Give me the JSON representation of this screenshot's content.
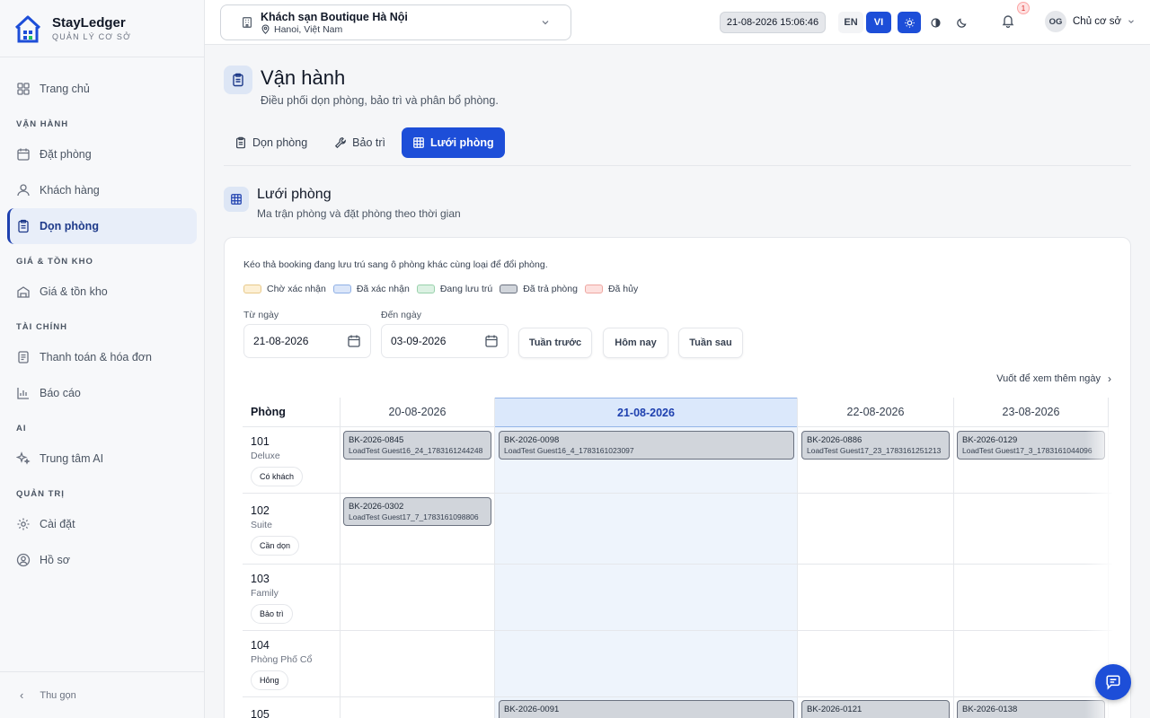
{
  "brand": {
    "name": "StayLedger",
    "sub": "QUẢN LÝ CƠ SỞ"
  },
  "sidebar": {
    "home": "Trang chủ",
    "sections": [
      {
        "title": "VẬN HÀNH",
        "items": [
          "Đặt phòng",
          "Khách hàng",
          "Dọn phòng"
        ]
      },
      {
        "title": "GIÁ & TỒN KHO",
        "items": [
          "Giá & tồn kho"
        ]
      },
      {
        "title": "TÀI CHÍNH",
        "items": [
          "Thanh toán & hóa đơn",
          "Báo cáo"
        ]
      },
      {
        "title": "AI",
        "items": [
          "Trung tâm AI"
        ]
      },
      {
        "title": "QUẢN TRỊ",
        "items": [
          "Cài đặt",
          "Hồ sơ"
        ]
      }
    ],
    "active": "Dọn phòng",
    "collapse_label": "Thu gọn"
  },
  "topbar": {
    "hotel_name": "Khách sạn Boutique Hà Nội",
    "hotel_location": "Hanoi, Việt Nam",
    "datetime": "21-08-2026 15:06:46",
    "lang_en": "EN",
    "lang_vi": "VI",
    "notification_count": "1",
    "user_initials": "OG",
    "user_name": "Chủ cơ sở"
  },
  "page": {
    "title": "Vận hành",
    "subtitle": "Điều phối dọn phòng, bảo trì và phân bổ phòng.",
    "tabs": [
      "Dọn phòng",
      "Bảo trì",
      "Lưới phòng"
    ],
    "active_tab": "Lưới phòng"
  },
  "section": {
    "title": "Lưới phòng",
    "subtitle": "Ma trận phòng và đặt phòng theo thời gian"
  },
  "grid_card": {
    "hint": "Kéo thả booking đang lưu trú sang ô phòng khác cùng loại để đổi phòng.",
    "legend": [
      {
        "label": "Chờ xác nhận",
        "fill": "#fdf0d5",
        "border": "#e8c98a"
      },
      {
        "label": "Đã xác nhận",
        "fill": "#dbe6f9",
        "border": "#8fb0e6"
      },
      {
        "label": "Đang lưu trú",
        "fill": "#dcf1e3",
        "border": "#98d1ab"
      },
      {
        "label": "Đã trả phòng",
        "fill": "#d1d5db",
        "border": "#6b7280"
      },
      {
        "label": "Đã hủy",
        "fill": "#fde0de",
        "border": "#eea7a1"
      }
    ],
    "from_label": "Từ ngày",
    "from_value": "21-08-2026",
    "to_label": "Đến ngày",
    "to_value": "03-09-2026",
    "prev_week": "Tuần trước",
    "today": "Hôm nay",
    "next_week": "Tuần sau",
    "swipe_hint": "Vuốt để xem thêm ngày",
    "room_header": "Phòng",
    "dates": [
      "20-08-2026",
      "21-08-2026",
      "22-08-2026",
      "23-08-2026"
    ],
    "today_date": "21-08-2026",
    "rooms": [
      {
        "number": "101",
        "type": "Deluxe",
        "status": "Có khách"
      },
      {
        "number": "102",
        "type": "Suite",
        "status": "Cần dọn"
      },
      {
        "number": "103",
        "type": "Family",
        "status": "Bảo trì"
      },
      {
        "number": "104",
        "type": "Phòng Phố Cổ",
        "status": "Hỏng"
      },
      {
        "number": "105",
        "type": "",
        "status": ""
      }
    ],
    "bookings": [
      {
        "code": "BK-2026-0845",
        "guest": "LoadTest Guest16_24_1783161244248",
        "room": "101",
        "date": "20-08-2026"
      },
      {
        "code": "BK-2026-0098",
        "guest": "LoadTest Guest16_4_1783161023097",
        "room": "101",
        "date": "21-08-2026"
      },
      {
        "code": "BK-2026-0886",
        "guest": "LoadTest Guest17_23_1783161251213",
        "room": "101",
        "date": "22-08-2026"
      },
      {
        "code": "BK-2026-0129",
        "guest": "LoadTest Guest17_3_1783161044096",
        "room": "101",
        "date": "23-08-2026"
      },
      {
        "code": "BK-2026-0302",
        "guest": "LoadTest Guest17_7_1783161098806",
        "room": "102",
        "date": "20-08-2026"
      },
      {
        "code": "BK-2026-0091",
        "guest": "",
        "room": "105",
        "date": "21-08-2026"
      },
      {
        "code": "BK-2026-0121",
        "guest": "",
        "room": "105",
        "date": "22-08-2026"
      },
      {
        "code": "BK-2026-0138",
        "guest": "",
        "room": "105",
        "date": "23-08-2026"
      }
    ]
  },
  "colors": {
    "primary": "#1d4ed8",
    "today_col": "#eef4fc",
    "checked_out": "#d1d5db"
  }
}
